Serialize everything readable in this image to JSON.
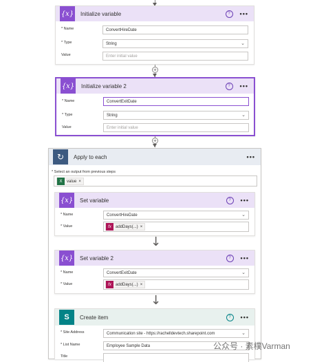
{
  "init_var_1": {
    "title": "Initialize variable",
    "name_label": "* Name",
    "name_value": "ConvertHireDate",
    "type_label": "* Type",
    "type_value": "String",
    "value_label": "Value",
    "value_placeholder": "Enter initial value"
  },
  "init_var_2": {
    "title": "Initialize variable 2",
    "name_label": "* Name",
    "name_value": "ConvertExitDate",
    "type_label": "* Type",
    "type_value": "String",
    "value_label": "Value",
    "value_placeholder": "Enter initial value"
  },
  "apply_each": {
    "title": "Apply to each",
    "select_label": "* Select an output from previous steps",
    "token_label": "value"
  },
  "set_var_1": {
    "title": "Set variable",
    "name_label": "* Name",
    "name_value": "ConvertHireDate",
    "value_label": "* Value",
    "token_label": "addDays(...)"
  },
  "set_var_2": {
    "title": "Set variable 2",
    "name_label": "* Name",
    "name_value": "ConvertExitDate",
    "value_label": "* Value",
    "token_label": "addDays(...)"
  },
  "create_item": {
    "title": "Create item",
    "site_label": "* Site Address",
    "site_value": "Communication site - https://rachelldevtech.sharepoint.com",
    "list_label": "* List Name",
    "list_value": "Employee Sample Data",
    "title_label": "Title"
  },
  "icons": {
    "variable": "{x}",
    "help": "?",
    "more": "•••",
    "plus": "+",
    "chevron": "⌄",
    "close": "×",
    "fx": "fx",
    "sharepoint": "S",
    "excel": "X",
    "loop": "↻",
    "down_arrow": "↓"
  },
  "watermark": "公众号 · 素樸Varman",
  "colors": {
    "variable_purple": "#8a4fd1",
    "header_purple": "#ebe1f7",
    "loop_blue": "#3d5a80",
    "sharepoint_teal": "#038387",
    "expression_pink": "#ad1457",
    "excel_green": "#217346"
  }
}
